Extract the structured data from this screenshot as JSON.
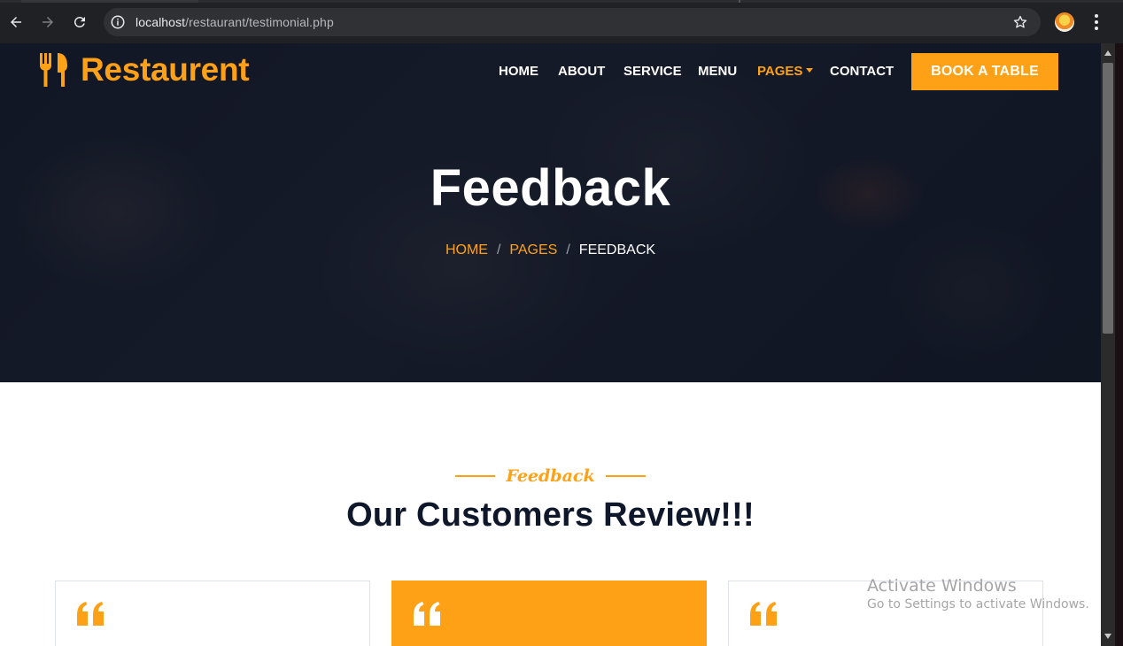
{
  "browser": {
    "url_host": "localhost",
    "url_path": "/restaurant/testimonial.php"
  },
  "site": {
    "logo_text": "Restaurent",
    "nav": [
      {
        "label": "HOME",
        "active": false
      },
      {
        "label": "ABOUT",
        "active": false
      },
      {
        "label": "SERVICE",
        "active": false
      },
      {
        "label": "MENU",
        "active": false
      },
      {
        "label": "PAGES",
        "active": true,
        "dropdown": true
      },
      {
        "label": "CONTACT",
        "active": false
      }
    ],
    "book_button": "BOOK A TABLE",
    "accent_color": "#fea116",
    "dark_color": "#0f172b"
  },
  "hero": {
    "title": "Feedback",
    "breadcrumb": [
      "HOME",
      "PAGES",
      "FEEDBACK"
    ],
    "separator": "/"
  },
  "section": {
    "tag": "Feedback",
    "title": "Our Customers Review!!!"
  },
  "cards": [
    {
      "quote_icon": "quote-left-icon",
      "highlight": false
    },
    {
      "quote_icon": "quote-left-icon",
      "highlight": true
    },
    {
      "quote_icon": "quote-left-icon",
      "highlight": false
    }
  ],
  "watermark": {
    "title": "Activate Windows",
    "subtitle": "Go to Settings to activate Windows."
  }
}
